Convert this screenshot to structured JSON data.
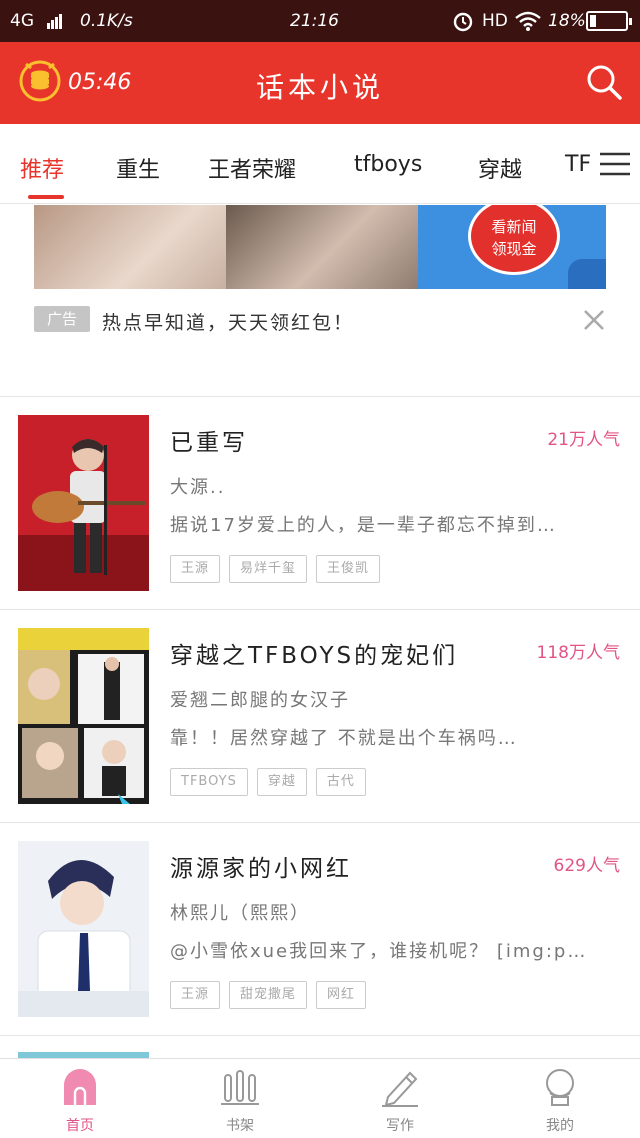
{
  "status_bar": {
    "network": "4G",
    "speed": "0.1K/s",
    "time": "21:16",
    "hd": "HD",
    "battery": "18%"
  },
  "header": {
    "title": "话本小说",
    "countdown": "05:46"
  },
  "tabs": [
    {
      "label": "推荐",
      "active": true
    },
    {
      "label": "重生"
    },
    {
      "label": "王者荣耀"
    },
    {
      "label": "tfboys"
    },
    {
      "label": "穿越"
    },
    {
      "label": "TF"
    }
  ],
  "ad": {
    "badge_line1": "看新闻",
    "badge_line2": "领现金",
    "label": "广告",
    "text": "热点早知道，天天领红包！"
  },
  "books": [
    {
      "title": "已重写",
      "popularity": "21万人气",
      "author": "大源..",
      "description": "据说17岁爱上的人，是一辈子都忘不掉到…",
      "tags": [
        "王源",
        "易烊千玺",
        "王俊凯"
      ]
    },
    {
      "title": "穿越之TFBOYS的宠妃们",
      "popularity": "118万人气",
      "author": "爱翘二郎腿的女汉子",
      "description": "靠！！居然穿越了     不就是出个车祸吗…",
      "tags": [
        "TFBOYS",
        "穿越",
        "古代"
      ]
    },
    {
      "title": "源源家的小网红",
      "popularity": "629人气",
      "author": "林熙儿（熙熙）",
      "description": "@小雪依xue我回来了，谁接机呢？ [img:p…",
      "tags": [
        "王源",
        "甜宠撒尾",
        "网红"
      ]
    }
  ],
  "bottom_nav": [
    {
      "label": "首页",
      "icon": "home-icon",
      "active": true
    },
    {
      "label": "书架",
      "icon": "bookshelf-icon"
    },
    {
      "label": "写作",
      "icon": "pencil-icon"
    },
    {
      "label": "我的",
      "icon": "profile-icon"
    }
  ],
  "colors": {
    "brand": "#e8352b",
    "popularity": "#e25486",
    "status_bar": "#3a1210"
  }
}
